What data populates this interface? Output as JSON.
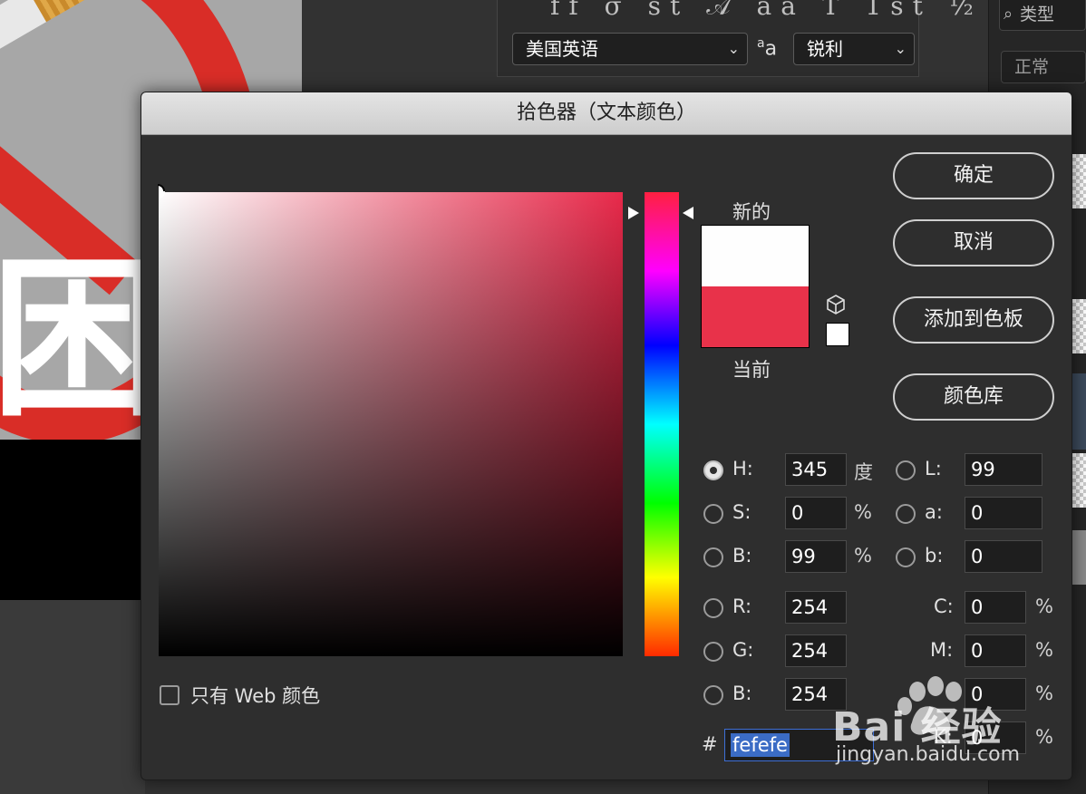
{
  "colors": {
    "new_color": "#fefefe",
    "current_color": "#e8324a",
    "hue_base": "#e8294a"
  },
  "character_panel": {
    "glyph_row": "ff σ st 𝒜 aa T 1st ½",
    "language": "美国英语",
    "antialias_icon": "aa-icon",
    "antialias": "锐利"
  },
  "layers_panel": {
    "kind_filter": "类型",
    "blend_mode": "正常"
  },
  "dialog": {
    "title": "拾色器（文本颜色）",
    "new_label": "新的",
    "current_label": "当前",
    "buttons": {
      "ok": "确定",
      "cancel": "取消",
      "add_to_swatches": "添加到色板",
      "color_libraries": "颜色库"
    },
    "hsb": {
      "h_label": "H:",
      "h_value": "345",
      "h_unit": "度",
      "s_label": "S:",
      "s_value": "0",
      "s_unit": "%",
      "b_label": "B:",
      "b_value": "99",
      "b_unit": "%"
    },
    "lab": {
      "l_label": "L:",
      "l_value": "99",
      "a_label": "a:",
      "a_value": "0",
      "b_label": "b:",
      "b_value": "0"
    },
    "rgb": {
      "r_label": "R:",
      "r_value": "254",
      "g_label": "G:",
      "g_value": "254",
      "b_label": "B:",
      "b_value": "254"
    },
    "cmyk": {
      "c_label": "C:",
      "c_value": "0",
      "m_label": "M:",
      "m_value": "0",
      "y_value": "0",
      "k_label": "K:",
      "k_value": "0",
      "unit": "%"
    },
    "hex_label": "#",
    "hex_value": "fefefe",
    "web_only_label": "只有 Web 颜色",
    "selected_mode": "H"
  },
  "watermark": {
    "brand": "Bai 经验",
    "url": "jingyan.baidu.com"
  }
}
